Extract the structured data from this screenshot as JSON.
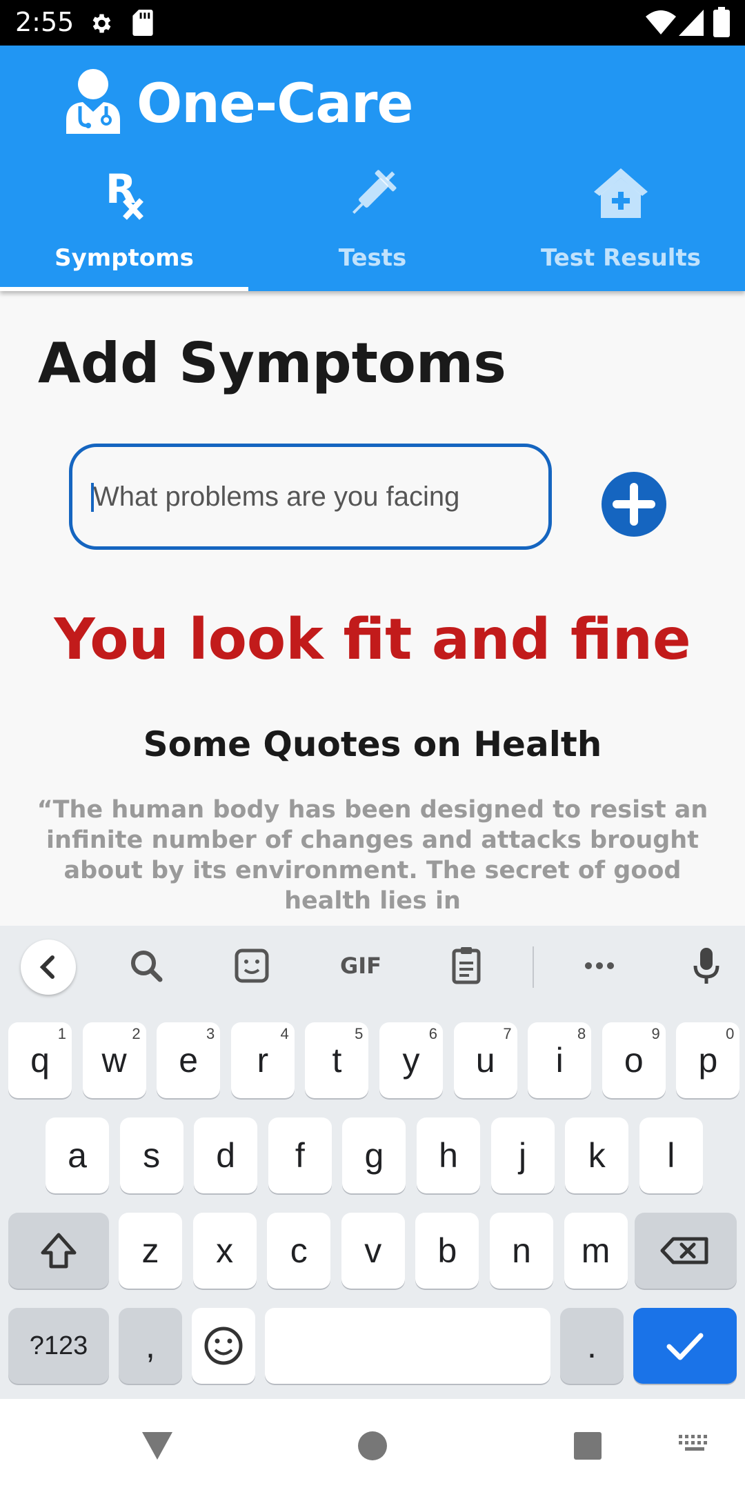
{
  "status": {
    "time": "2:55"
  },
  "app": {
    "title": "One-Care"
  },
  "tabs": [
    {
      "label": "Symptoms",
      "icon": "rx-icon",
      "selected": true
    },
    {
      "label": "Tests",
      "icon": "syringe-icon",
      "selected": false
    },
    {
      "label": "Test Results",
      "icon": "clinic-home-icon",
      "selected": false
    }
  ],
  "main": {
    "title": "Add Symptoms",
    "input_placeholder": "What problems are you facing",
    "status_message": "You look fit and fine",
    "quotes_title": "Some Quotes on Health",
    "quote": "“The human body has been designed to resist an infinite number of changes and attacks brought about by its environment. The secret of good health lies in"
  },
  "keyboard": {
    "toolbar": [
      "back-icon",
      "search-icon",
      "sticker-icon",
      "GIF",
      "clipboard-icon",
      "more-icon",
      "mic-icon"
    ],
    "row1": [
      {
        "k": "q",
        "h": "1"
      },
      {
        "k": "w",
        "h": "2"
      },
      {
        "k": "e",
        "h": "3"
      },
      {
        "k": "r",
        "h": "4"
      },
      {
        "k": "t",
        "h": "5"
      },
      {
        "k": "y",
        "h": "6"
      },
      {
        "k": "u",
        "h": "7"
      },
      {
        "k": "i",
        "h": "8"
      },
      {
        "k": "o",
        "h": "9"
      },
      {
        "k": "p",
        "h": "0"
      }
    ],
    "row2": [
      "a",
      "s",
      "d",
      "f",
      "g",
      "h",
      "j",
      "k",
      "l"
    ],
    "row3": [
      "z",
      "x",
      "c",
      "v",
      "b",
      "n",
      "m"
    ],
    "row4": {
      "symbols": "?123",
      "comma": ",",
      "period": "."
    }
  },
  "colors": {
    "appbar": "#2196F3",
    "accent": "#1565C0",
    "warning": "#C21B1B"
  }
}
